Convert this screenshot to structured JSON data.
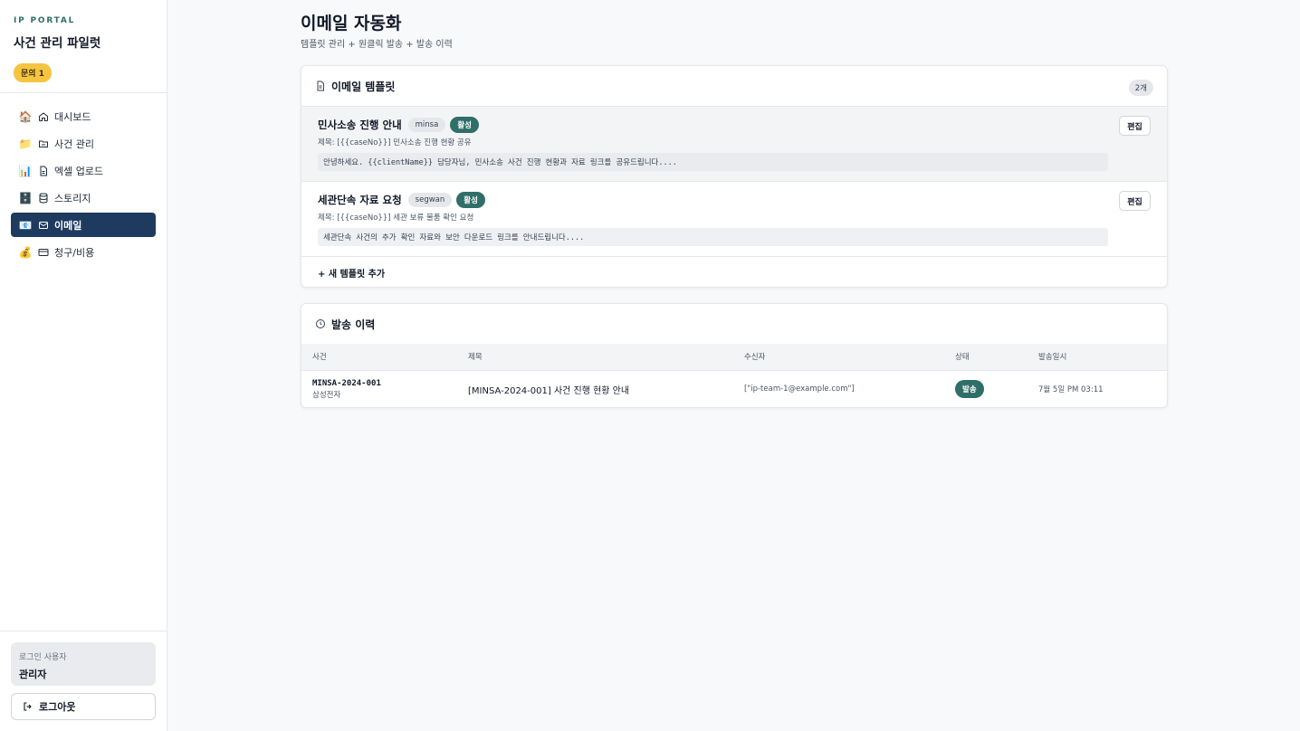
{
  "sidebar": {
    "eyebrow": "IP PORTAL",
    "title": "사건 관리 파일럿",
    "badge": "문의 1",
    "items": [
      {
        "emoji": "🏠",
        "label": "대시보드",
        "icon": "home-icon"
      },
      {
        "emoji": "📁",
        "label": "사건 관리",
        "icon": "folder-icon"
      },
      {
        "emoji": "📊",
        "label": "엑셀 업로드",
        "icon": "file-icon"
      },
      {
        "emoji": "🗄️",
        "label": "스토리지",
        "icon": "database-icon"
      },
      {
        "emoji": "📧",
        "label": "이메일",
        "icon": "mail-icon",
        "active": true
      },
      {
        "emoji": "💰",
        "label": "청구/비용",
        "icon": "credit-card-icon"
      }
    ],
    "user_label": "로그인 사용자",
    "user_name": "관리자",
    "logout_label": "로그아웃"
  },
  "page": {
    "title": "이메일 자동화",
    "subtitle": "템플릿 관리 + 원클릭 발송 + 발송 이력"
  },
  "templates": {
    "title": "이메일 템플릿",
    "count": "2개",
    "items": [
      {
        "name": "민사소송 진행 안내",
        "key": "minsa",
        "status": "활성",
        "subject": "제목: [{{caseNo}}] 민사소송 진행 현황 공유",
        "body": "안녕하세요. {{clientName}} 담당자님, 민사소송 사건 진행 현황과 자료 링크를 공유드립니다....",
        "edit_label": "편집"
      },
      {
        "name": "세관단속 자료 요청",
        "key": "segwan",
        "status": "활성",
        "subject": "제목: [{{caseNo}}] 세관 보류 물품 확인 요청",
        "body": "세관단속 사건의 추가 확인 자료와 보안 다운로드 링크를 안내드립니다....",
        "edit_label": "편집"
      }
    ],
    "add_label": "+ 새 템플릿 추가"
  },
  "history": {
    "title": "발송 이력",
    "columns": [
      "사건",
      "제목",
      "수신자",
      "상태",
      "발송일시"
    ],
    "rows": [
      {
        "case_no": "MINSA-2024-001",
        "client": "삼성전자",
        "subject": "[MINSA-2024-001] 사건 진행 현황 안내",
        "recipients": "[\"ip-team-1@example.com\"]",
        "status": "발송",
        "sent_at": "7월 5일 PM 03:11"
      }
    ]
  },
  "colors": {
    "nav_active": "#1e3a5f",
    "accent_teal": "#2f6f68",
    "badge_yellow": "#f5c542"
  }
}
